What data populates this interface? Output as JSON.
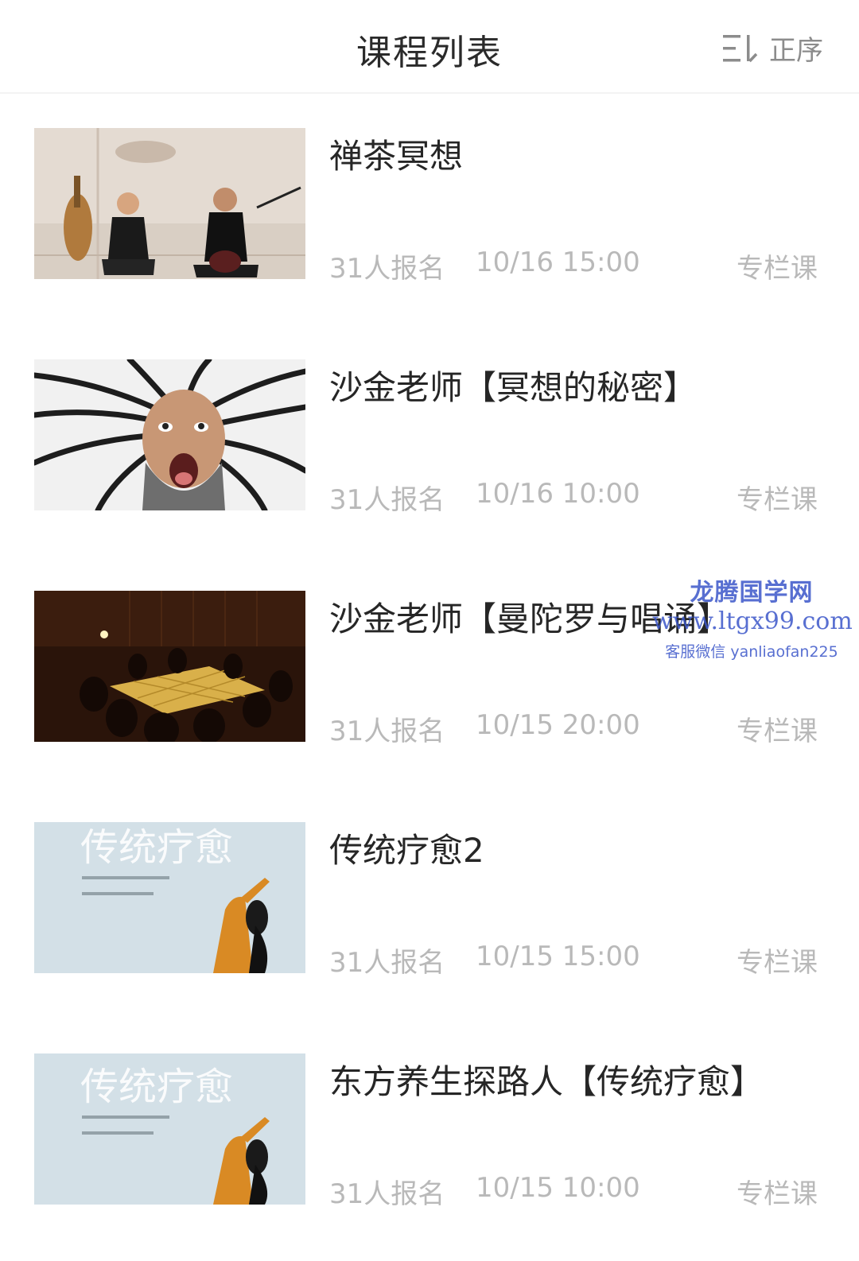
{
  "header": {
    "title": "课程列表",
    "sort_label": "正序",
    "sort_icon": "sort-ascending-icon"
  },
  "courses": [
    {
      "title": "禅茶冥想",
      "enrolled": "31人报名",
      "time": "10/16 15:00",
      "type": "专栏课"
    },
    {
      "title": "沙金老师【冥想的秘密】",
      "enrolled": "31人报名",
      "time": "10/16 10:00",
      "type": "专栏课"
    },
    {
      "title": "沙金老师【曼陀罗与唱诵】",
      "enrolled": "31人报名",
      "time": "10/15 20:00",
      "type": "专栏课"
    },
    {
      "title": "传统疗愈2",
      "enrolled": "31人报名",
      "time": "10/15 15:00",
      "type": "专栏课",
      "thumb_text": "传统疗愈"
    },
    {
      "title": "东方养生探路人【传统疗愈】",
      "enrolled": "31人报名",
      "time": "10/15 10:00",
      "type": "专栏课",
      "thumb_text": "传统疗愈"
    }
  ],
  "watermark": {
    "name": "龙腾国学网",
    "url": "www.ltgx99.com",
    "contact": "客服微信 yanliaofan225"
  },
  "colors": {
    "meta_gray": "#b9b9b9",
    "watermark_blue": "#3c57c9"
  }
}
